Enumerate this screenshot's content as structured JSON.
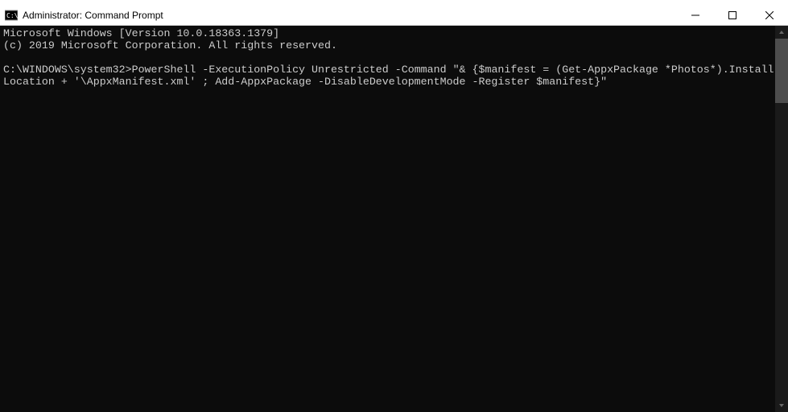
{
  "window": {
    "title": "Administrator: Command Prompt"
  },
  "terminal": {
    "banner_line1": "Microsoft Windows [Version 10.0.18363.1379]",
    "banner_line2": "(c) 2019 Microsoft Corporation. All rights reserved.",
    "prompt": "C:\\WINDOWS\\system32>",
    "command": "PowerShell -ExecutionPolicy Unrestricted -Command \"& {$manifest = (Get-AppxPackage *Photos*).InstallLocation + '\\AppxManifest.xml' ; Add-AppxPackage -DisableDevelopmentMode -Register $manifest}\""
  }
}
